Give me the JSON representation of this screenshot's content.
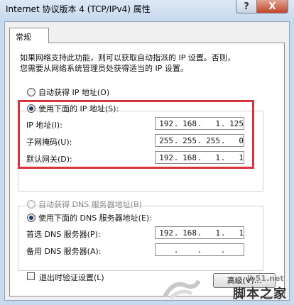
{
  "window": {
    "title": "Internet 协议版本 4 (TCP/IPv4) 属性",
    "help_label": "?",
    "close_label": "X"
  },
  "tabs": [
    {
      "label": "常规"
    }
  ],
  "description": {
    "line1": "如果网络支持此功能，则可以获取自动指派的 IP 设置。否则，",
    "line2": "您需要从网络系统管理员处获得适当的 IP 设置。"
  },
  "ip_section": {
    "auto_option": "自动获得 IP 地址(O)",
    "manual_option": "使用下面的 IP 地址(S):",
    "selected": "manual",
    "fields": [
      {
        "label": "IP 地址(I):",
        "octets": [
          "192",
          "168",
          "1",
          "125"
        ]
      },
      {
        "label": "子网掩码(U):",
        "octets": [
          "255",
          "255",
          "255",
          "0"
        ]
      },
      {
        "label": "默认网关(D):",
        "octets": [
          "192",
          "168",
          "1",
          "1"
        ]
      }
    ]
  },
  "dns_section": {
    "auto_option": "自动获得 DNS 服务器地址(B)",
    "manual_option": "使用下面的 DNS 服务器地址(E):",
    "selected": "manual",
    "fields": [
      {
        "label": "首选 DNS 服务器(P):",
        "octets": [
          "192",
          "168",
          "1",
          "1"
        ]
      },
      {
        "label": "备用 DNS 服务器(A):",
        "octets": [
          "",
          "",
          "",
          ""
        ]
      }
    ]
  },
  "validate_checkbox": {
    "label": "退出时验证设置(L)",
    "checked": false
  },
  "advanced_button": {
    "label": "高级(V)..."
  },
  "watermark": {
    "site": "jb51.net",
    "name": "脚本之家"
  },
  "colors": {
    "highlight_box": "#d9333b",
    "close_button": "#c5452b",
    "title_bar": "#c7d9ee"
  }
}
